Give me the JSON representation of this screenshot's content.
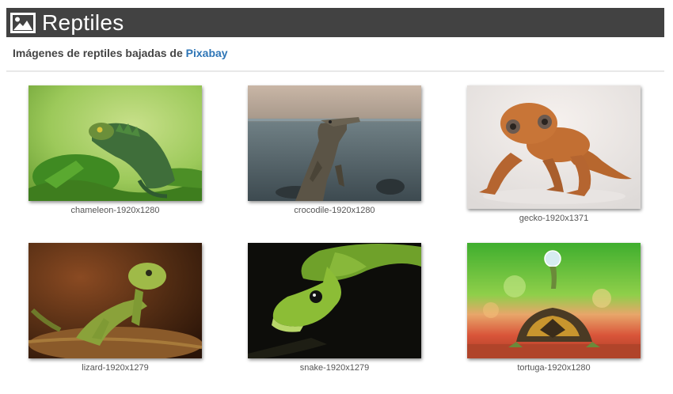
{
  "header": {
    "title": "Reptiles",
    "icon": "image-icon"
  },
  "subtitle": {
    "text": "Imágenes de reptiles bajadas de ",
    "link_text": "Pixabay"
  },
  "gallery": [
    {
      "caption": "chameleon-1920x1280"
    },
    {
      "caption": "crocodile-1920x1280"
    },
    {
      "caption": "gecko-1920x1371"
    },
    {
      "caption": "lizard-1920x1279"
    },
    {
      "caption": "snake-1920x1279"
    },
    {
      "caption": "tortuga-1920x1280"
    }
  ],
  "colors": {
    "header_bg": "#424242",
    "link": "#2e75b6",
    "text": "#444444"
  }
}
